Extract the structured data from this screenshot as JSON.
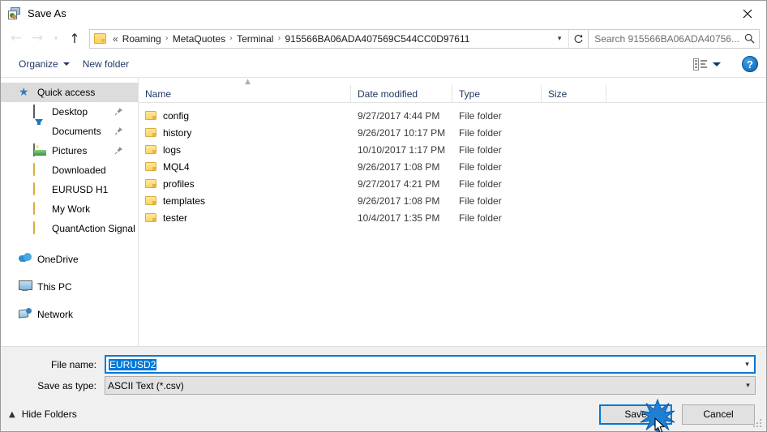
{
  "window": {
    "title": "Save As",
    "app_icon": "save-as-icon",
    "close_icon": "close-icon"
  },
  "nav": {
    "back_icon": "back-arrow-icon",
    "forward_icon": "forward-arrow-icon",
    "recent_icon": "chevron-down-icon",
    "up_icon": "up-arrow-icon",
    "address": {
      "folder_icon": "folder-icon",
      "prefix": "«",
      "crumbs": [
        "Roaming",
        "MetaQuotes",
        "Terminal",
        "915566BA06ADA407569C544CC0D97611"
      ],
      "separator": "›",
      "dropdown_icon": "chevron-down-icon",
      "refresh_icon": "refresh-icon"
    },
    "search": {
      "placeholder": "Search 915566BA06ADA40756...",
      "icon": "search-icon"
    }
  },
  "commandbar": {
    "organize_label": "Organize",
    "new_folder_label": "New folder",
    "view_icon": "view-layout-icon",
    "view_caret_icon": "chevron-down-icon",
    "help_label": "?",
    "help_icon": "help-icon"
  },
  "sidebar": {
    "items": [
      {
        "label": "Quick access",
        "icon": "star-pin-icon",
        "level": "root",
        "selected": true,
        "pinned": false
      },
      {
        "label": "Desktop",
        "icon": "desktop-icon",
        "level": "child",
        "selected": false,
        "pinned": true
      },
      {
        "label": "Documents",
        "icon": "documents-icon",
        "level": "child",
        "selected": false,
        "pinned": true
      },
      {
        "label": "Pictures",
        "icon": "pictures-icon",
        "level": "child",
        "selected": false,
        "pinned": true
      },
      {
        "label": "Downloaded",
        "icon": "folder-icon",
        "level": "child",
        "selected": false,
        "pinned": false
      },
      {
        "label": "EURUSD H1",
        "icon": "folder-icon",
        "level": "child",
        "selected": false,
        "pinned": false
      },
      {
        "label": "My Work",
        "icon": "folder-icon",
        "level": "child",
        "selected": false,
        "pinned": false
      },
      {
        "label": "QuantAction Signal",
        "icon": "folder-icon",
        "level": "child",
        "selected": false,
        "pinned": false
      },
      {
        "label": "OneDrive",
        "icon": "onedrive-icon",
        "level": "root",
        "selected": false,
        "pinned": false
      },
      {
        "label": "This PC",
        "icon": "this-pc-icon",
        "level": "root",
        "selected": false,
        "pinned": false
      },
      {
        "label": "Network",
        "icon": "network-icon",
        "level": "root",
        "selected": false,
        "pinned": false
      }
    ]
  },
  "filelist": {
    "sort_indicator_icon": "sort-ascending-icon",
    "columns": [
      "Name",
      "Date modified",
      "Type",
      "Size"
    ],
    "rows": [
      {
        "name": "config",
        "date": "9/27/2017 4:44 PM",
        "type": "File folder",
        "size": ""
      },
      {
        "name": "history",
        "date": "9/26/2017 10:17 PM",
        "type": "File folder",
        "size": ""
      },
      {
        "name": "logs",
        "date": "10/10/2017 1:17 PM",
        "type": "File folder",
        "size": ""
      },
      {
        "name": "MQL4",
        "date": "9/26/2017 1:08 PM",
        "type": "File folder",
        "size": ""
      },
      {
        "name": "profiles",
        "date": "9/27/2017 4:21 PM",
        "type": "File folder",
        "size": ""
      },
      {
        "name": "templates",
        "date": "9/26/2017 1:08 PM",
        "type": "File folder",
        "size": ""
      },
      {
        "name": "tester",
        "date": "10/4/2017 1:35 PM",
        "type": "File folder",
        "size": ""
      }
    ]
  },
  "form": {
    "filename_label": "File name:",
    "filename_value": "EURUSD2",
    "filename_dropdown_icon": "chevron-down-icon",
    "savetype_label": "Save as type:",
    "savetype_value": "ASCII Text (*.csv)",
    "savetype_dropdown_icon": "chevron-down-icon"
  },
  "footer": {
    "hide_folders_label": "Hide Folders",
    "hide_folders_icon": "chevron-up-icon",
    "save_label": "Save",
    "cancel_label": "Cancel",
    "resize_grip_icon": "resize-grip-icon",
    "click_burst_icon": "click-burst-icon",
    "cursor_icon": "mouse-cursor-icon"
  },
  "colors": {
    "accent": "#0078d7",
    "header_text": "#1f3864",
    "selection": "#0078d7",
    "chrome": "#f0f0f0"
  }
}
